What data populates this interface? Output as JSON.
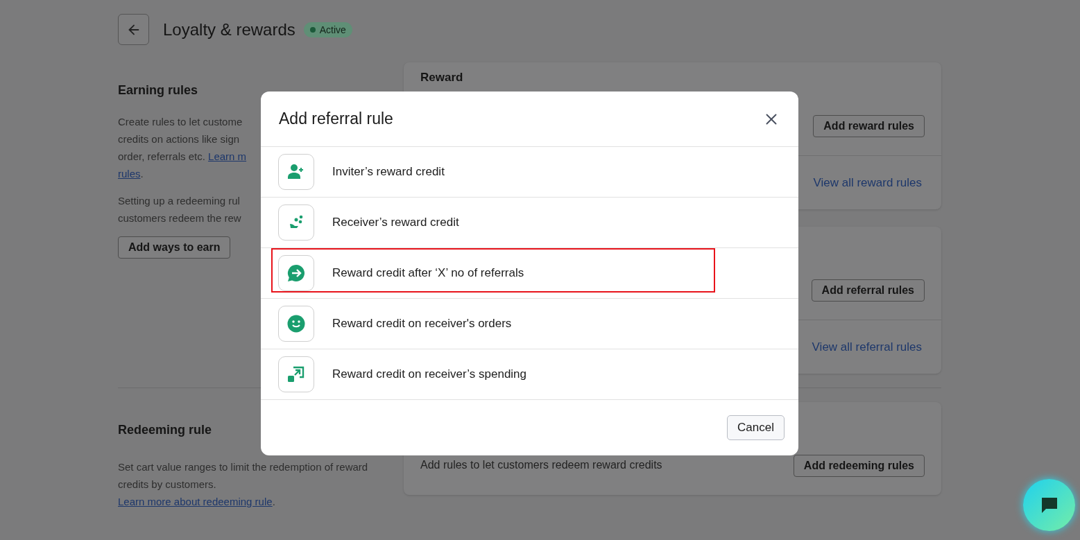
{
  "header": {
    "title": "Loyalty & rewards",
    "status": "Active"
  },
  "earning_section": {
    "heading": "Earning rules",
    "paragraphs": [
      [
        [
          {
            "kind": "text",
            "text": "Create rules to let custome"
          }
        ],
        [
          {
            "kind": "text",
            "text": "credits on actions like sign"
          }
        ],
        [
          {
            "kind": "text",
            "text": "order, referrals etc. "
          },
          {
            "kind": "link",
            "text": "Learn m"
          }
        ],
        [
          {
            "kind": "link",
            "text": "rules"
          },
          {
            "kind": "text",
            "text": "."
          }
        ]
      ],
      [
        [
          {
            "kind": "text",
            "text": "Setting up a redeeming rul"
          }
        ],
        [
          {
            "kind": "text",
            "text": "customers redeem the rew"
          }
        ]
      ]
    ],
    "button": "Add ways to earn"
  },
  "cards": [
    {
      "heading": "Reward",
      "button": "Add reward rules",
      "link": "View all reward rules"
    },
    {
      "button": "Add referral rules",
      "link": "View all referral rules"
    }
  ],
  "redeeming_section": {
    "heading": "Redeeming rule",
    "description": [
      {
        "kind": "text",
        "text": "Set cart value ranges to limit the redemption of reward credits by customers. "
      },
      {
        "kind": "link",
        "text": "Learn more about redeeming rule"
      },
      {
        "kind": "text",
        "text": "."
      }
    ]
  },
  "redeeming_card": {
    "description": "Add rules to let customers redeem reward credits",
    "button": "Add redeeming rules"
  },
  "modal": {
    "title": "Add referral rule",
    "rows": [
      {
        "kind": "inviter",
        "label": "Inviter’s reward credit",
        "highlighted": false
      },
      {
        "kind": "receiver",
        "label": "Receiver’s reward credit",
        "highlighted": false
      },
      {
        "kind": "count",
        "label": "Reward credit after ‘X’ no of referrals",
        "highlighted": true
      },
      {
        "kind": "orders",
        "label": "Reward credit on receiver's orders",
        "highlighted": false
      },
      {
        "kind": "spending",
        "label": "Reward credit on receiver’s spending",
        "highlighted": false
      }
    ],
    "cancel_button": "Cancel"
  }
}
